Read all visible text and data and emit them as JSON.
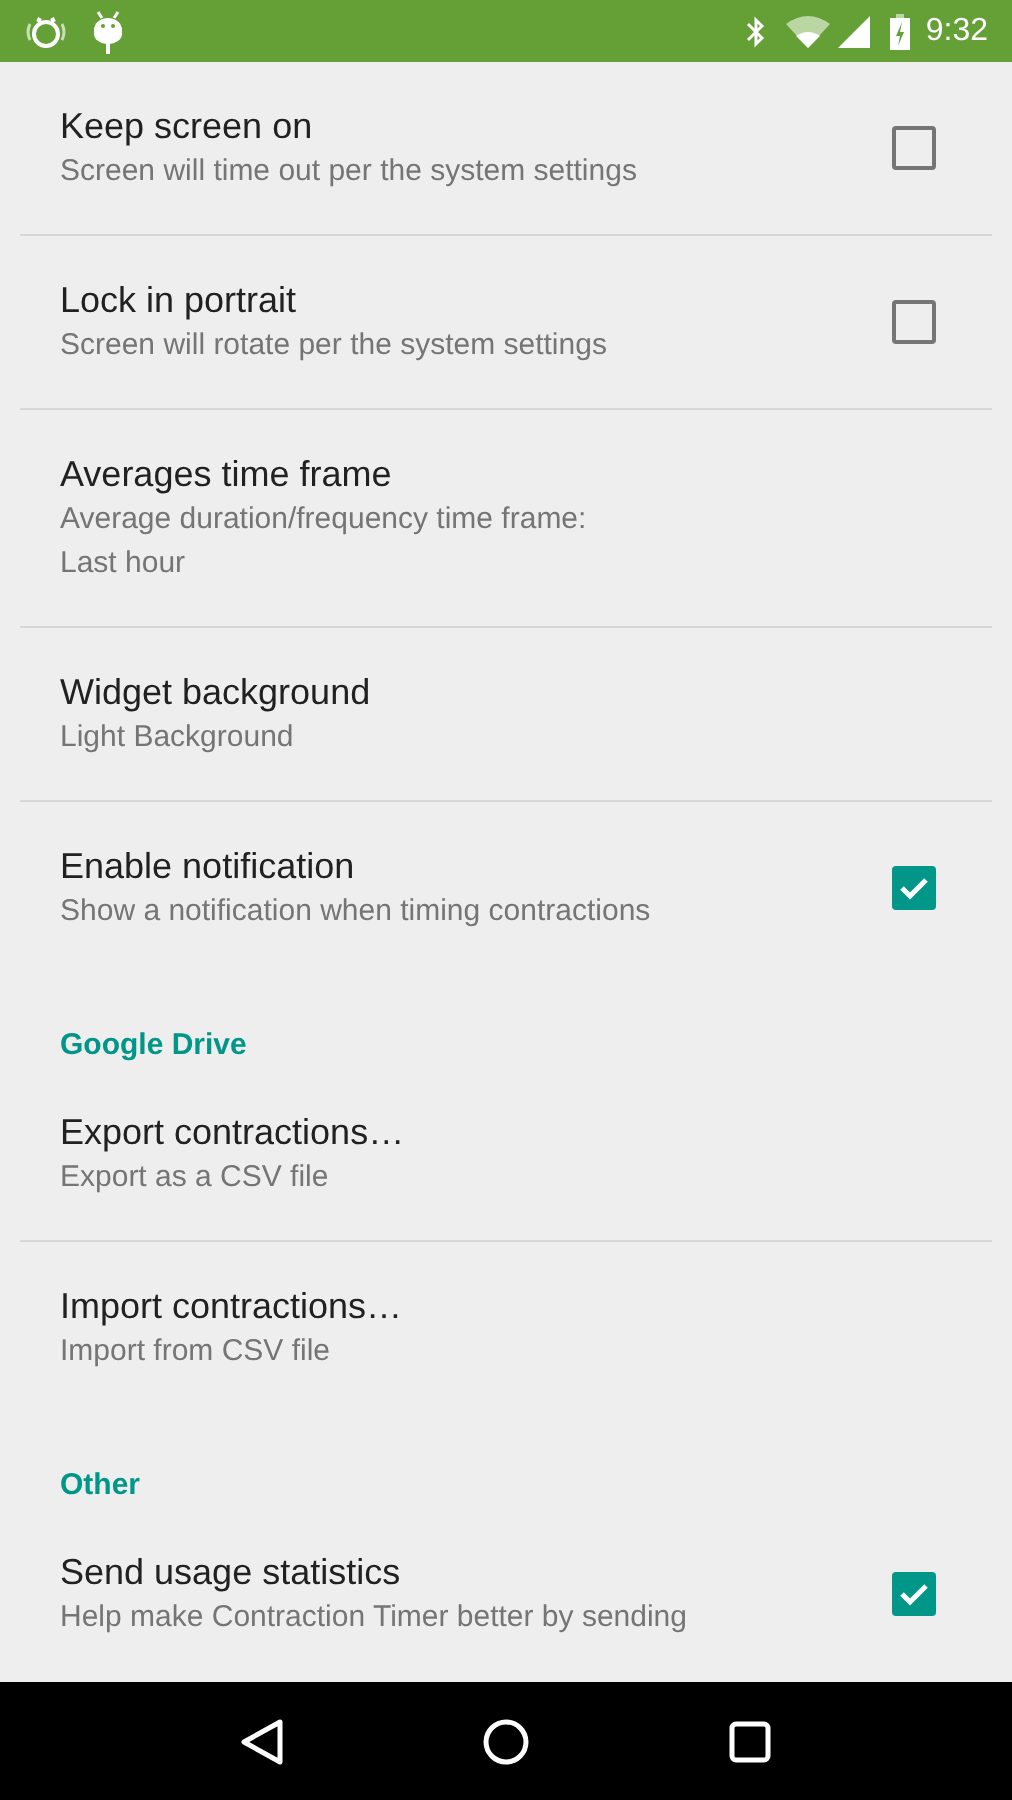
{
  "status_bar": {
    "time": "9:32"
  },
  "groups": [
    {
      "items": [
        {
          "title": "Keep screen on",
          "summary": [
            "Screen will time out per the system settings"
          ],
          "kind": "checkbox",
          "checked": false
        },
        {
          "title": "Lock in portrait",
          "summary": [
            "Screen will rotate per the system settings"
          ],
          "kind": "checkbox",
          "checked": false
        },
        {
          "title": "Averages time frame",
          "summary": [
            "Average duration/frequency time frame:",
            "Last hour"
          ],
          "kind": "list"
        },
        {
          "title": "Widget background",
          "summary": [
            "Light Background"
          ],
          "kind": "list"
        },
        {
          "title": "Enable notification",
          "summary": [
            "Show a notification when timing contractions"
          ],
          "kind": "checkbox",
          "checked": true
        }
      ]
    },
    {
      "header": "Google Drive",
      "items": [
        {
          "title": "Export contractions…",
          "summary": [
            "Export as a CSV file"
          ],
          "kind": "action"
        },
        {
          "title": "Import contractions…",
          "summary": [
            "Import from CSV file"
          ],
          "kind": "action"
        }
      ]
    },
    {
      "header": "Other",
      "items": [
        {
          "title": "Send usage statistics",
          "summary": [
            "Help make Contraction Timer better by sending"
          ],
          "kind": "checkbox",
          "checked": true
        }
      ]
    }
  ]
}
